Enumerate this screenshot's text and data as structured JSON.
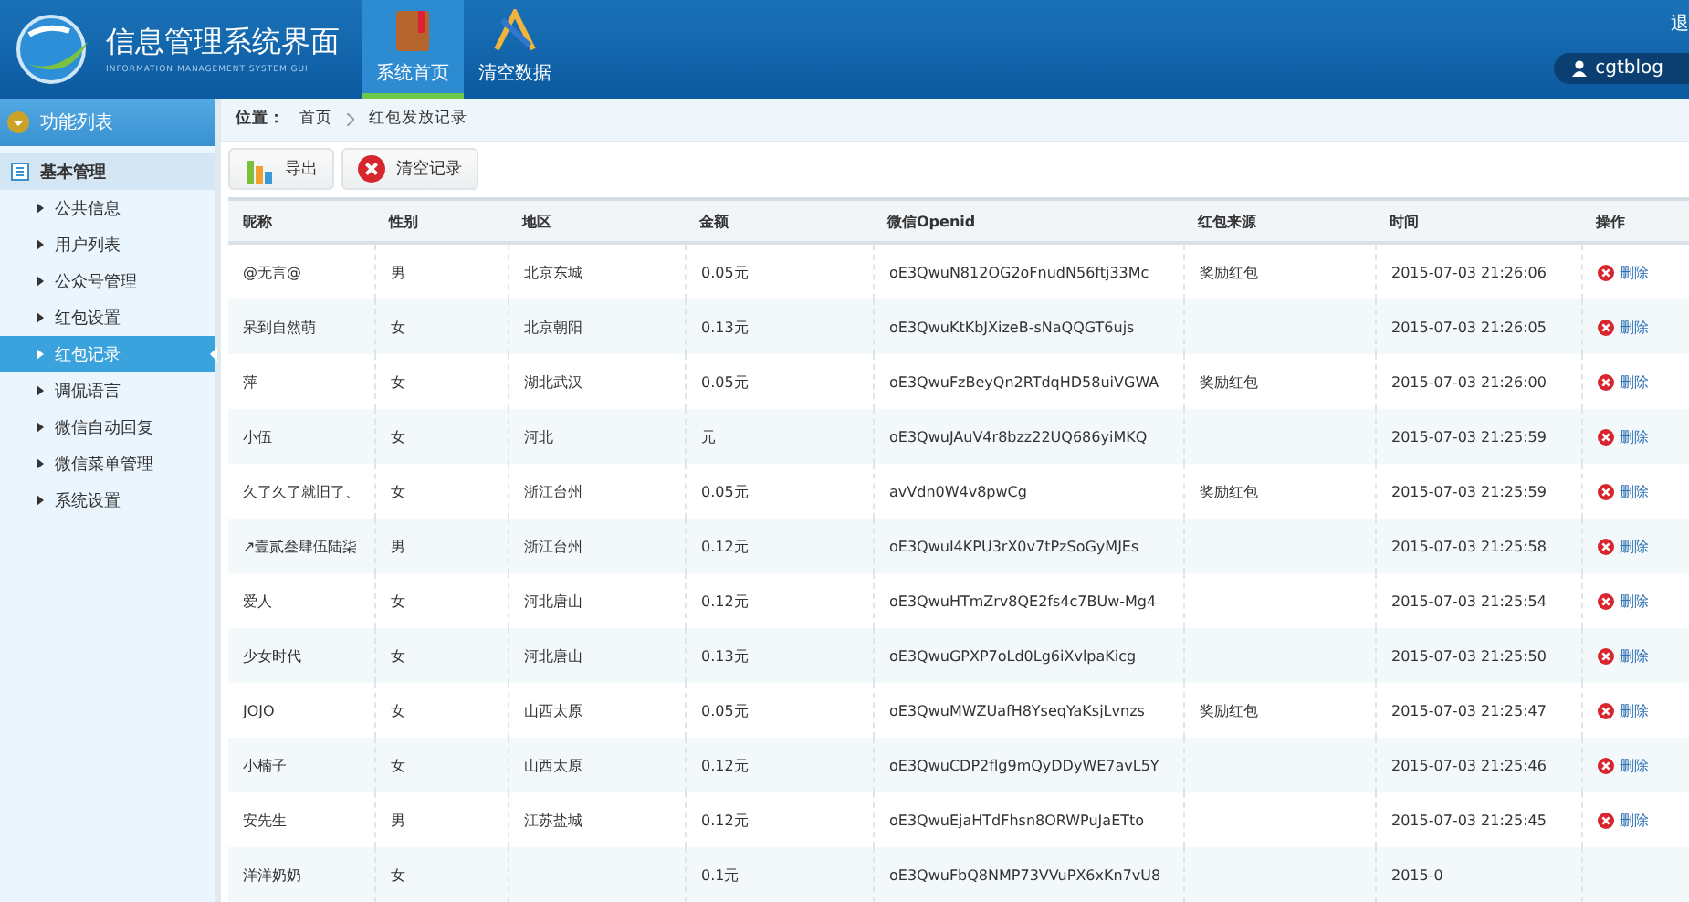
{
  "header": {
    "title": "信息管理系统界面",
    "subtitle": "INFORMATION MANAGEMENT SYSTEM GUI",
    "nav": [
      {
        "label": "系统首页",
        "kind": "book",
        "selected": true
      },
      {
        "label": "清空数据",
        "kind": "tools",
        "selected": false
      }
    ],
    "logout": "退",
    "user": "cgtblog"
  },
  "sidebar": {
    "title": "功能列表",
    "section": "基本管理",
    "items": [
      {
        "label": "公共信息",
        "selected": false
      },
      {
        "label": "用户列表",
        "selected": false
      },
      {
        "label": "公众号管理",
        "selected": false
      },
      {
        "label": "红包设置",
        "selected": false
      },
      {
        "label": "红包记录",
        "selected": true
      },
      {
        "label": "调侃语言",
        "selected": false
      },
      {
        "label": "微信自动回复",
        "selected": false
      },
      {
        "label": "微信菜单管理",
        "selected": false
      },
      {
        "label": "系统设置",
        "selected": false
      }
    ]
  },
  "breadcrumb": {
    "label": "位置：",
    "items": [
      "首页",
      "红包发放记录"
    ]
  },
  "toolbar": [
    {
      "label": "导出",
      "kind": "export"
    },
    {
      "label": "清空记录",
      "kind": "clear"
    }
  ],
  "table": {
    "columns": [
      "昵称",
      "性别",
      "地区",
      "金额",
      "微信Openid",
      "红包来源",
      "时间",
      "操作"
    ],
    "rows": [
      {
        "cells": [
          "@无言@",
          "男",
          "北京东城",
          "0.05元",
          "oE3QwuN812OG2oFnudN56ftj33Mc",
          "奖励红包",
          "2015-07-03 21:26:06"
        ],
        "action": "删除"
      },
      {
        "cells": [
          "呆到自然萌",
          "女",
          "北京朝阳",
          "0.13元",
          "oE3QwuKtKbJXizeB-sNaQQGT6ujs",
          "",
          "2015-07-03 21:26:05"
        ],
        "action": "删除"
      },
      {
        "cells": [
          "萍",
          "女",
          "湖北武汉",
          "0.05元",
          "oE3QwuFzBeyQn2RTdqHD58uiVGWA",
          "奖励红包",
          "2015-07-03 21:26:00"
        ],
        "action": "删除"
      },
      {
        "cells": [
          "小伍",
          "女",
          "河北",
          "元",
          "oE3QwuJAuV4r8bzz22UQ686yiMKQ",
          "",
          "2015-07-03 21:25:59"
        ],
        "action": "删除"
      },
      {
        "cells": [
          "久了久了就旧了、",
          "女",
          "浙江台州",
          "0.05元",
          "avVdn0W4v8pwCg",
          "奖励红包",
          "2015-07-03 21:25:59"
        ],
        "action": "删除"
      },
      {
        "cells": [
          "↗壹贰叁肆伍陆柒",
          "男",
          "浙江台州",
          "0.12元",
          "oE3QwuI4KPU3rX0v7tPzSoGyMJEs",
          "",
          "2015-07-03 21:25:58"
        ],
        "action": "删除"
      },
      {
        "cells": [
          "爱人",
          "女",
          "河北唐山",
          "0.12元",
          "oE3QwuHTmZrv8QE2fs4c7BUw-Mg4",
          "",
          "2015-07-03 21:25:54"
        ],
        "action": "删除"
      },
      {
        "cells": [
          "少女时代",
          "女",
          "河北唐山",
          "0.13元",
          "oE3QwuGPXP7oLd0Lg6iXvlpaKicg",
          "",
          "2015-07-03 21:25:50"
        ],
        "action": "删除"
      },
      {
        "cells": [
          "JOJO",
          "女",
          "山西太原",
          "0.05元",
          "oE3QwuMWZUafH8YseqYaKsjLvnzs",
          "奖励红包",
          "2015-07-03 21:25:47"
        ],
        "action": "删除"
      },
      {
        "cells": [
          "小楠子",
          "女",
          "山西太原",
          "0.12元",
          "oE3QwuCDP2flg9mQyDDyWE7avL5Y",
          "",
          "2015-07-03 21:25:46"
        ],
        "action": "删除"
      },
      {
        "cells": [
          "安先生",
          "男",
          "江苏盐城",
          "0.12元",
          "oE3QwuEjaHTdFhsn8ORWPuJaETto",
          "",
          "2015-07-03 21:25:45"
        ],
        "action": "删除"
      },
      {
        "cells": [
          "洋洋奶奶",
          "女",
          "",
          "0.1元",
          "oE3QwuFbQ8NMP73VVuPX6xKn7vU8",
          "",
          "2015-0"
        ]
      }
    ]
  }
}
